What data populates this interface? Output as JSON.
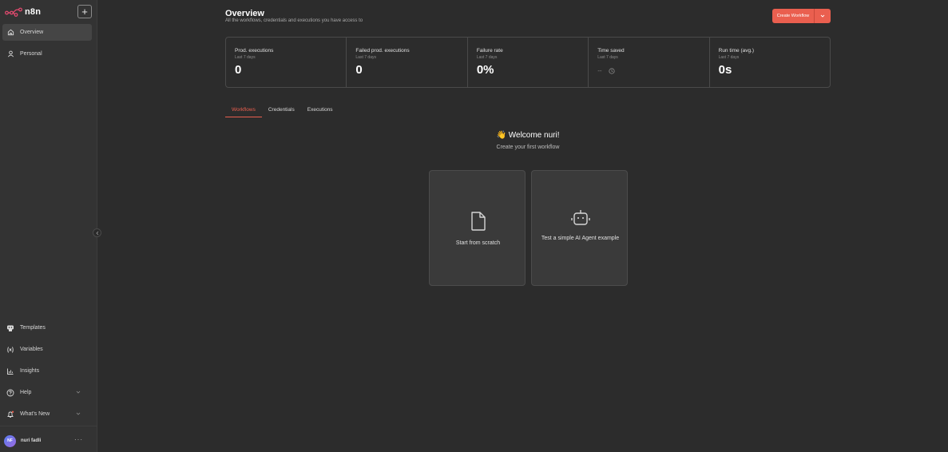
{
  "app": {
    "logo_text": "n8n"
  },
  "sidebar": {
    "create_button": "+",
    "top_items": [
      {
        "label": "Overview",
        "icon": "home-icon",
        "active": true
      },
      {
        "label": "Personal",
        "icon": "user-icon",
        "active": false
      }
    ],
    "bottom_items": [
      {
        "label": "Templates",
        "icon": "templates-icon"
      },
      {
        "label": "Variables",
        "icon": "variables-icon"
      },
      {
        "label": "Insights",
        "icon": "insights-icon"
      },
      {
        "label": "Help",
        "icon": "help-icon"
      },
      {
        "label": "What's New",
        "icon": "bell-icon"
      }
    ],
    "user": {
      "initials": "NF",
      "name": "nuri fadli",
      "menu": "···"
    }
  },
  "header": {
    "title": "Overview",
    "subtitle": "All the workflows, credentials and executions you have access to",
    "create_button": "Create Workflow"
  },
  "stats": [
    {
      "label": "Prod. executions",
      "period": "Last 7 days",
      "value": "0"
    },
    {
      "label": "Failed prod. executions",
      "period": "Last 7 days",
      "value": "0"
    },
    {
      "label": "Failure rate",
      "period": "Last 7 days",
      "value": "0%"
    },
    {
      "label": "Time saved",
      "period": "Last 7 days",
      "value": "--"
    },
    {
      "label": "Run time (avg.)",
      "period": "Last 7 days",
      "value": "0s"
    }
  ],
  "tabs": [
    {
      "label": "Workflows",
      "active": true
    },
    {
      "label": "Credentials",
      "active": false
    },
    {
      "label": "Executions",
      "active": false
    }
  ],
  "welcome": {
    "title": "👋 Welcome nuri!",
    "subtitle": "Create your first workflow"
  },
  "cards": [
    {
      "label": "Start from scratch",
      "icon": "file-icon"
    },
    {
      "label": "Test a simple AI Agent example",
      "icon": "robot-icon"
    }
  ],
  "colors": {
    "accent": "#ea5f4f",
    "background": "#2c2c2c",
    "sidebar": "#333333"
  }
}
